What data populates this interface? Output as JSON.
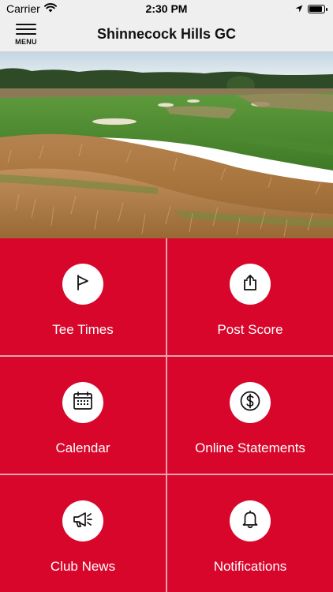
{
  "status_bar": {
    "carrier": "Carrier",
    "time": "2:30 PM",
    "battery_level": 0.9
  },
  "nav": {
    "menu_label": "MENU",
    "title": "Shinnecock Hills GC"
  },
  "hero": {
    "image_subject": "golf course fairway with tall grass"
  },
  "theme": {
    "tile_color": "#d8062b",
    "divider_color": "#e8a4ad",
    "icon_bg": "#ffffff"
  },
  "tiles": [
    {
      "label": "Tee Times",
      "icon": "flag-icon"
    },
    {
      "label": "Post Score",
      "icon": "share-icon"
    },
    {
      "label": "Calendar",
      "icon": "calendar-icon"
    },
    {
      "label": "Online Statements",
      "icon": "dollar-icon"
    },
    {
      "label": "Club News",
      "icon": "megaphone-icon"
    },
    {
      "label": "Notifications",
      "icon": "bell-icon"
    }
  ]
}
